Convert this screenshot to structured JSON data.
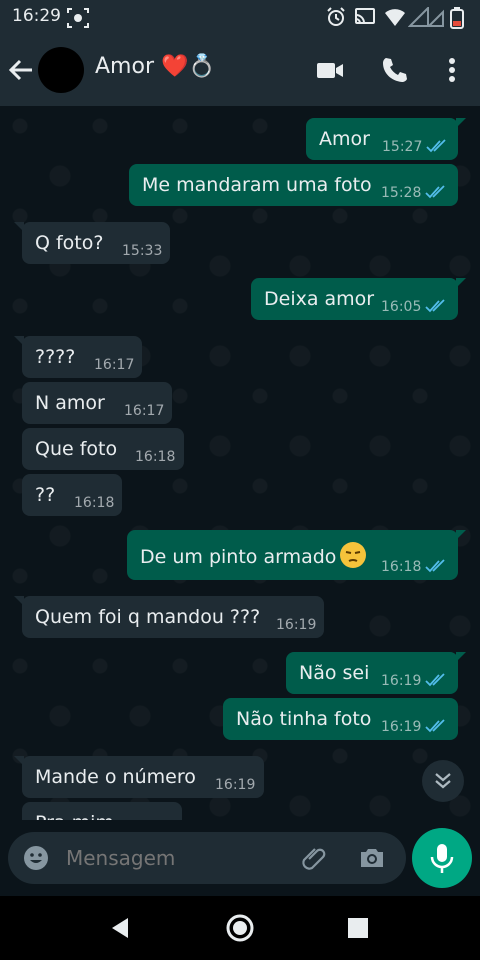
{
  "status_bar": {
    "time": "16:29"
  },
  "header": {
    "contact_name": "Amor ❤️💍"
  },
  "messages": [
    {
      "dir": "out",
      "text": "Amor",
      "time": "15:27"
    },
    {
      "dir": "out",
      "text": "Me mandaram uma foto",
      "time": "15:28"
    },
    {
      "dir": "in",
      "text": "Q foto?",
      "time": "15:33"
    },
    {
      "dir": "out",
      "text": "Deixa amor",
      "time": "16:05"
    },
    {
      "dir": "in",
      "text": "????",
      "time": "16:17"
    },
    {
      "dir": "in",
      "text": "N amor",
      "time": "16:17"
    },
    {
      "dir": "in",
      "text": "Que foto",
      "time": "16:18"
    },
    {
      "dir": "in",
      "text": "??",
      "time": "16:18"
    },
    {
      "dir": "out",
      "text": "De um pinto armado",
      "time": "16:18"
    },
    {
      "dir": "in",
      "text": "Quem foi q mandou ???",
      "time": "16:19"
    },
    {
      "dir": "out",
      "text": "Não sei",
      "time": "16:19"
    },
    {
      "dir": "out",
      "text": "Não tinha foto",
      "time": "16:19"
    },
    {
      "dir": "in",
      "text": "Mande o número",
      "time": "16:19"
    },
    {
      "dir": "in",
      "text": "Pra mim",
      "time": ""
    }
  ],
  "composer": {
    "placeholder": "Mensagem"
  },
  "colors": {
    "outgoing": "#005c4b",
    "incoming": "#1f2c34",
    "accent": "#00a884",
    "ticks": "#53bdeb"
  }
}
